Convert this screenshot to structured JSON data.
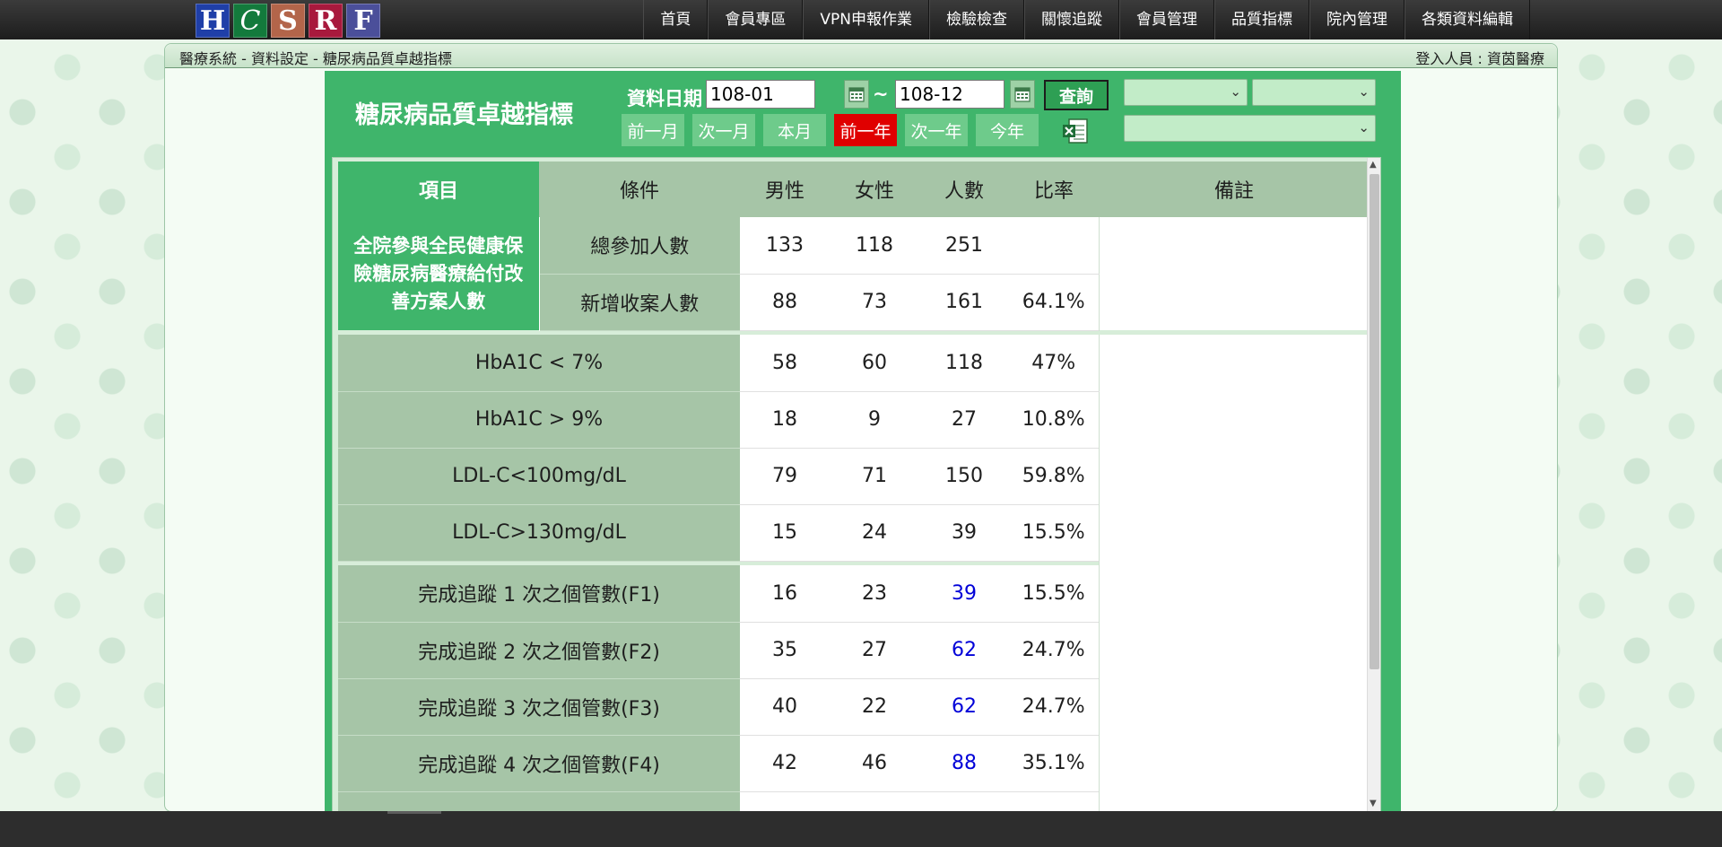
{
  "logos": [
    "H",
    "C",
    "S",
    "R",
    "F"
  ],
  "logo_colors": [
    "#1f3fa8",
    "#137a3c",
    "#b3654a",
    "#a8193d",
    "#4b4f9a"
  ],
  "nav": [
    "首頁",
    "會員專區",
    "VPN申報作業",
    "檢驗檢查",
    "關懷追蹤",
    "會員管理",
    "品質指標",
    "院內管理",
    "各類資料編輯"
  ],
  "breadcrumb": "醫療系統 - 資料設定 - 糖尿病品質卓越指標",
  "login_info": "登入人員 : 資茵醫療",
  "panel": {
    "title": "糖尿病品質卓越指標",
    "date_label": "資料日期 :",
    "date_from": "108-01",
    "date_sep": "~",
    "date_to": "108-12",
    "query_label": "查詢",
    "quick_buttons": [
      "前一月",
      "次一月",
      "本月",
      "前一年",
      "次一年",
      "今年"
    ],
    "quick_active": "前一年",
    "selects": [
      "",
      "",
      ""
    ]
  },
  "colors": {
    "accent_green": "#3fb56b",
    "header_sage": "#a6c5a7",
    "active_red": "#e00000",
    "link_blue": "#0000d8"
  },
  "table": {
    "headers": [
      "項目",
      "條件",
      "男性",
      "女性",
      "人數",
      "比率",
      "備註"
    ],
    "group1_label": "全院參與全民健康保險糖尿病醫療給付改善方案人數",
    "group1_rows": [
      {
        "cond": "總參加人數",
        "male": "133",
        "female": "118",
        "total": "251",
        "ratio": ""
      },
      {
        "cond": "新增收案人數",
        "male": "88",
        "female": "73",
        "total": "161",
        "ratio": "64.1%"
      }
    ],
    "group2_rows": [
      {
        "cond": "HbA1C < 7%",
        "male": "58",
        "female": "60",
        "total": "118",
        "ratio": "47%"
      },
      {
        "cond": "HbA1C > 9%",
        "male": "18",
        "female": "9",
        "total": "27",
        "ratio": "10.8%"
      },
      {
        "cond": "LDL-C<100mg/dL",
        "male": "79",
        "female": "71",
        "total": "150",
        "ratio": "59.8%"
      },
      {
        "cond": "LDL-C>130mg/dL",
        "male": "15",
        "female": "24",
        "total": "39",
        "ratio": "15.5%"
      }
    ],
    "group3_rows": [
      {
        "cond": "完成追蹤 1 次之個管數(F1)",
        "male": "16",
        "female": "23",
        "total": "39",
        "ratio": "15.5%"
      },
      {
        "cond": "完成追蹤 2 次之個管數(F2)",
        "male": "35",
        "female": "27",
        "total": "62",
        "ratio": "24.7%"
      },
      {
        "cond": "完成追蹤 3 次之個管數(F3)",
        "male": "40",
        "female": "22",
        "total": "62",
        "ratio": "24.7%"
      },
      {
        "cond": "完成追蹤 4 次之個管數(F4)",
        "male": "42",
        "female": "46",
        "total": "88",
        "ratio": "35.1%"
      }
    ]
  }
}
